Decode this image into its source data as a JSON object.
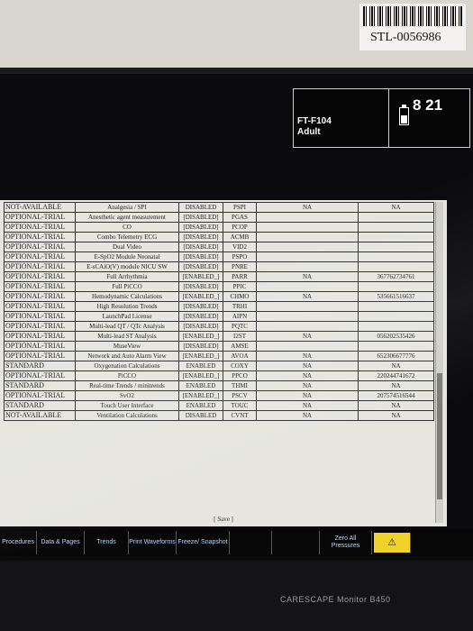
{
  "asset_tag": {
    "text": "STL-0056986"
  },
  "header": {
    "bed": "FT-F104",
    "patient_type": "Adult",
    "time": "8 21",
    "battery_level": 0.55
  },
  "table": {
    "rows": [
      [
        "NOT-AVAILABLE",
        "Analgesia / SPI",
        "DISABLED",
        "PSPI",
        "NA",
        "NA"
      ],
      [
        "OPTIONAL-TRIAL",
        "Anesthetic agent measurement",
        "[DISABLED]",
        "PGAS",
        "",
        ""
      ],
      [
        "OPTIONAL-TRIAL",
        "CO",
        "[DISABLED]",
        "PCOP",
        "",
        ""
      ],
      [
        "OPTIONAL-TRIAL",
        "Combo Telemetry ECG",
        "[DISABLED]",
        "ACMB",
        "",
        ""
      ],
      [
        "OPTIONAL-TRIAL",
        "Dual Video",
        "[DISABLED]",
        "VID2",
        "",
        ""
      ],
      [
        "OPTIONAL-TRIAL",
        "E-SpO2 Module Neonatal",
        "[DISABLED]",
        "PSPO",
        "",
        ""
      ],
      [
        "OPTIONAL-TRIAL",
        "E-sCAiO(V) module NICU SW",
        "[DISABLED]",
        "PNRE",
        "",
        ""
      ],
      [
        "OPTIONAL-TRIAL",
        "Full Arrhythmia",
        "[ENABLED_]",
        "PARR",
        "NA",
        "367762734761"
      ],
      [
        "OPTIONAL-TRIAL",
        "Full PiCCO",
        "[DISABLED]",
        "PPIC",
        "",
        ""
      ],
      [
        "OPTIONAL-TRIAL",
        "Hemodynamic Calculations",
        "[ENABLED_]",
        "CHMO",
        "NA",
        "535661516637"
      ],
      [
        "OPTIONAL-TRIAL",
        "High Resolution Trends",
        "[DISABLED]",
        "TRHI",
        "",
        ""
      ],
      [
        "OPTIONAL-TRIAL",
        "LaunchPad License",
        "[DISABLED]",
        "AIPN",
        "",
        ""
      ],
      [
        "OPTIONAL-TRIAL",
        "Multi-lead QT / QTc Analysis",
        "[DISABLED]",
        "PQTC",
        "",
        ""
      ],
      [
        "OPTIONAL-TRIAL",
        "Multi-lead ST Analysis",
        "[ENABLED_]",
        "I2ST",
        "NA",
        "056202535426"
      ],
      [
        "OPTIONAL-TRIAL",
        "MuseView",
        "[DISABLED]",
        "AMSE",
        "",
        ""
      ],
      [
        "OPTIONAL-TRIAL",
        "Network and Auto Alarm View",
        "[ENABLED_]",
        "AVOA",
        "NA",
        "652306677776"
      ],
      [
        "STANDARD",
        "Oxygenation Calculations",
        "ENABLED",
        "COXY",
        "NA",
        "NA"
      ],
      [
        "OPTIONAL-TRIAL",
        "PiCCO",
        "[ENABLED_]",
        "PPCO",
        "NA",
        "220244741672"
      ],
      [
        "STANDARD",
        "Real-time Trends / minitrends",
        "ENABLED",
        "THMI",
        "NA",
        "NA"
      ],
      [
        "OPTIONAL-TRIAL",
        "SvO2",
        "[ENABLED_]",
        "PSCV",
        "NA",
        "207574516544"
      ],
      [
        "STANDARD",
        "Touch User Interface",
        "ENABLED",
        "TOUC",
        "NA",
        "NA"
      ],
      [
        "NOT-AVAILABLE",
        "Ventilation Calculations",
        "DISABLED",
        "CVNT",
        "NA",
        "NA"
      ]
    ],
    "save_label": "[ Save ]"
  },
  "menu": [
    "Procedures",
    "Data & Pages",
    "Trends",
    "Print Waveforms",
    "Freeze/ Snapshot",
    "",
    "",
    "Zero All Pressures"
  ],
  "footer": {
    "brand": "CARESCAPE Monitor B450"
  }
}
